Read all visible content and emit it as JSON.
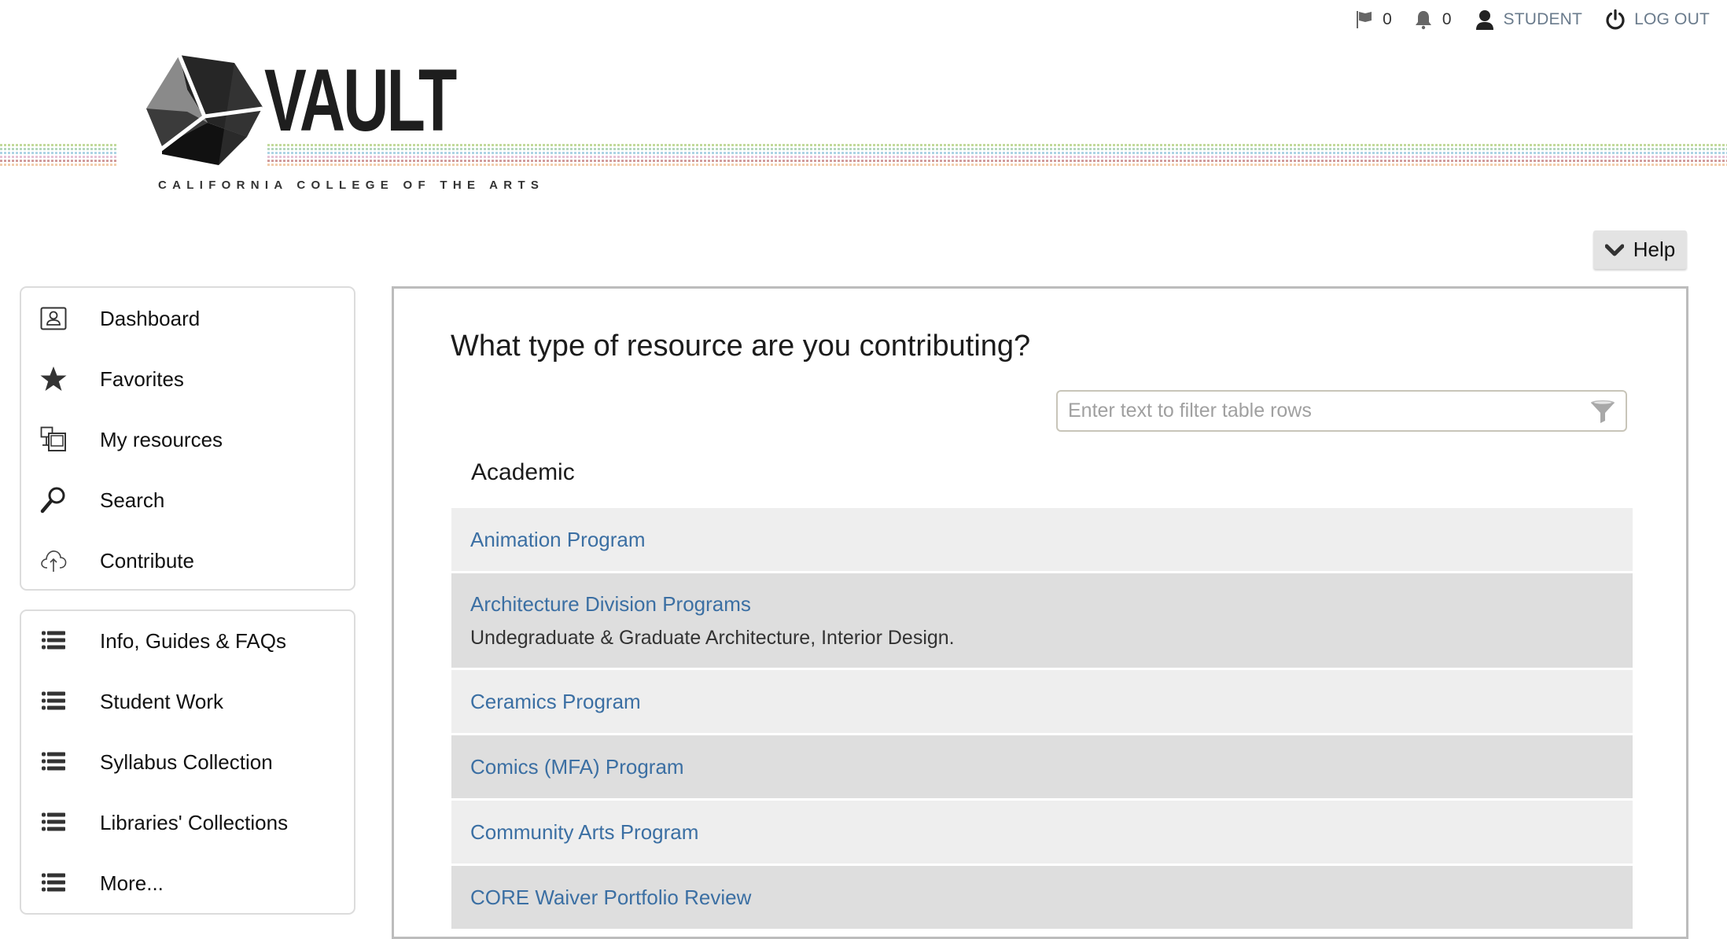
{
  "topbar": {
    "flags_count": "0",
    "notifications_count": "0",
    "user_label": "STUDENT",
    "logout_label": "LOG OUT"
  },
  "logo": {
    "wordmark": "VAULT",
    "tagline": "CALIFORNIA COLLEGE OF THE ARTS",
    "stripe_colors": [
      "#b8d48a",
      "#a9d0b0",
      "#9fcde0",
      "#e2b8cf",
      "#c98a8a",
      "#f0c49e"
    ]
  },
  "help": {
    "label": "Help"
  },
  "sidebar": {
    "main_items": [
      {
        "label": "Dashboard",
        "icon": "dashboard-icon"
      },
      {
        "label": "Favorites",
        "icon": "star-icon"
      },
      {
        "label": "My resources",
        "icon": "my-resources-icon"
      },
      {
        "label": "Search",
        "icon": "search-icon"
      },
      {
        "label": "Contribute",
        "icon": "cloud-upload-icon"
      }
    ],
    "collection_items": [
      {
        "label": "Info, Guides & FAQs",
        "icon": "list-icon"
      },
      {
        "label": "Student Work",
        "icon": "list-icon"
      },
      {
        "label": "Syllabus Collection",
        "icon": "list-icon"
      },
      {
        "label": "Libraries' Collections",
        "icon": "list-icon"
      },
      {
        "label": "More...",
        "icon": "list-icon"
      }
    ]
  },
  "main": {
    "title": "What type of resource are you contributing?",
    "filter": {
      "placeholder": "Enter text to filter table rows",
      "value": ""
    },
    "section": "Academic",
    "rows": [
      {
        "title": "Animation Program",
        "description": ""
      },
      {
        "title": "Architecture Division Programs",
        "description": "Undegraduate & Graduate Architecture, Interior Design."
      },
      {
        "title": "Ceramics Program",
        "description": ""
      },
      {
        "title": "Comics (MFA) Program",
        "description": ""
      },
      {
        "title": "Community Arts Program",
        "description": ""
      },
      {
        "title": "CORE Waiver Portfolio Review",
        "description": ""
      }
    ]
  },
  "colors": {
    "link": "#3b6fa3",
    "row_light": "#eeeeee",
    "row_dark": "#dedede",
    "topbar_link": "#6a7b8c"
  }
}
